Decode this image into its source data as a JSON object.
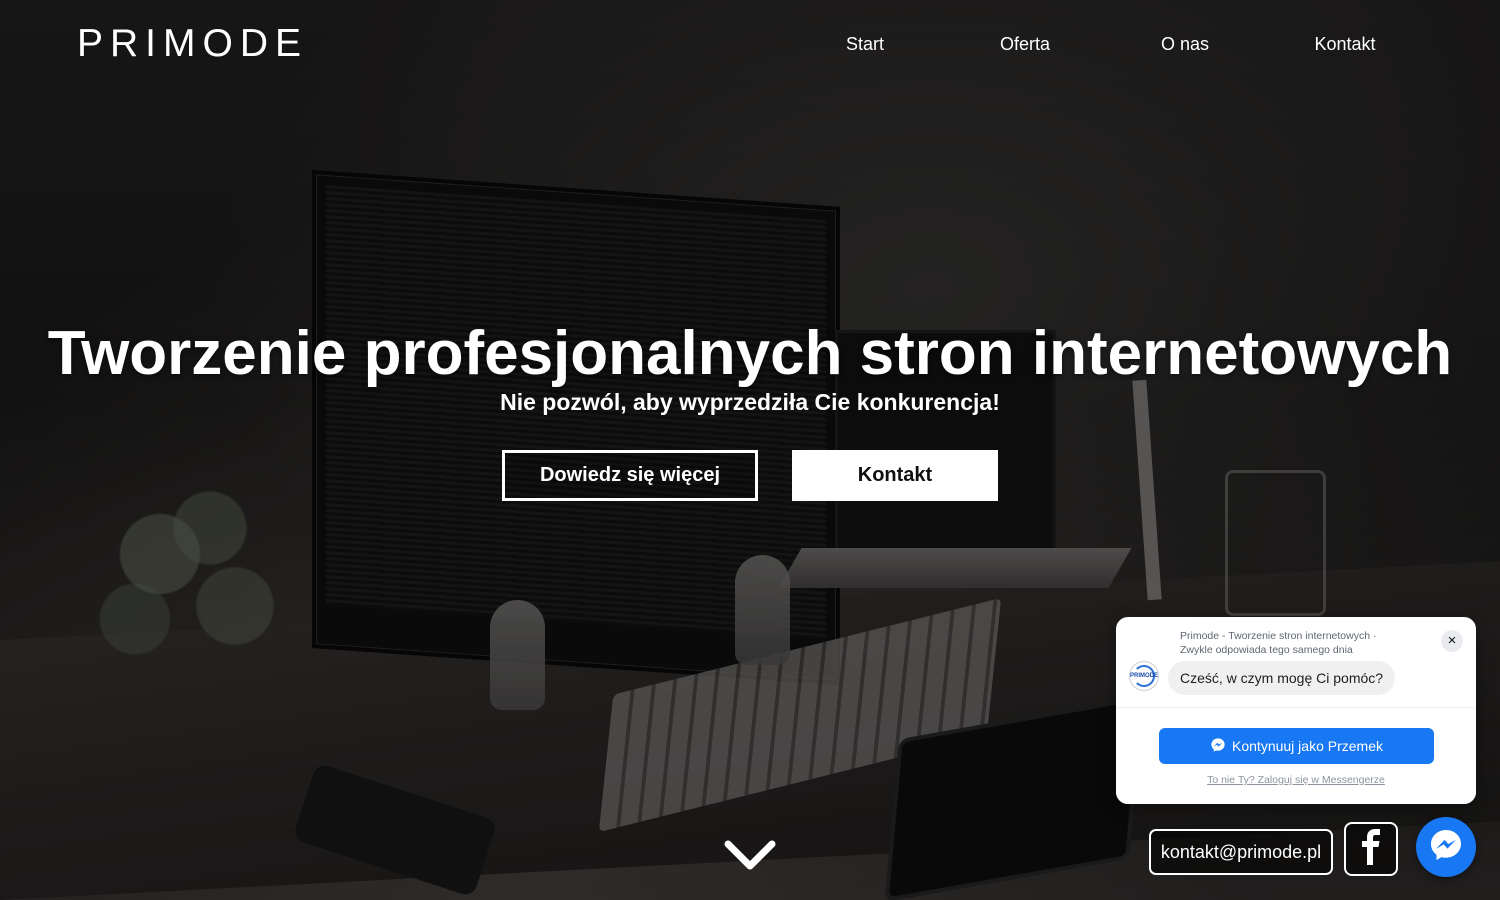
{
  "header": {
    "brand": "PRIMODE",
    "nav": [
      "Start",
      "Oferta",
      "O nas",
      "Kontakt"
    ]
  },
  "hero": {
    "title": "Tworzenie profesjonalnych stron internetowych",
    "subtitle": "Nie pozwól, aby wyprzedziła Cie konkurencja!",
    "primary_button": "Dowiedz się więcej",
    "secondary_button": "Kontakt"
  },
  "chat": {
    "page_name": "Primode - Tworzenie stron internetowych ·",
    "response_time": "Zwykle odpowiada tego samego dnia",
    "greeting": "Cześć, w czym mogę Ci pomóc?",
    "avatar_text": "PRIMODE",
    "continue_button": "Kontynuuj jako Przemek",
    "not_you_link": "To nie Ty? Zaloguj się w Messengerze",
    "close_symbol": "×"
  },
  "contact": {
    "email": "kontakt@primode.pl"
  },
  "icons": {
    "scroll": "chevron-down-icon",
    "facebook": "facebook-icon",
    "messenger": "messenger-icon"
  },
  "colors": {
    "messenger_blue": "#1877f2",
    "text_white": "#ffffff"
  }
}
